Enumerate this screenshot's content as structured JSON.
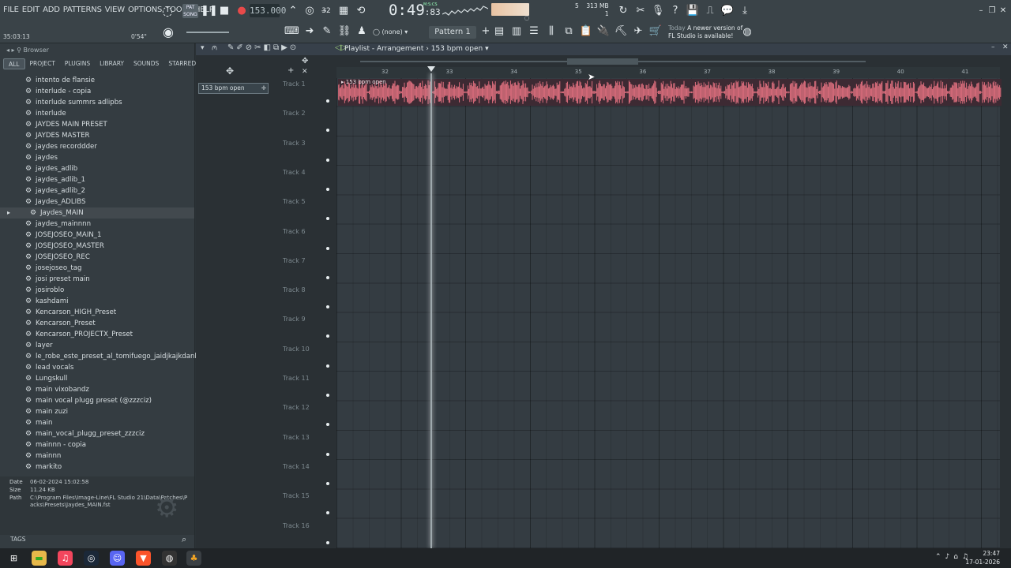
{
  "menu": [
    "FILE",
    "EDIT",
    "ADD",
    "PATTERNS",
    "VIEW",
    "OPTIONS",
    "TOOLS",
    "HELP"
  ],
  "transport": {
    "mode": "SONG",
    "pat_label": "PAT",
    "tempo": "153.000",
    "time": "0:49",
    "time_frac": ":83",
    "time_units": "M:S:CS",
    "cpu_value": "5",
    "ram": "313 MB",
    "poly": "1"
  },
  "hint_bar": {
    "left": "35:03:13",
    "right": "0'54\""
  },
  "pattern": {
    "label": "Pattern 1",
    "channel": "(none)"
  },
  "update_notice": {
    "day": "Today",
    "line1": "A newer version of",
    "line2": "FL Studio is available!"
  },
  "browser": {
    "title": "Browser",
    "tabs": [
      "ALL",
      "PROJECT",
      "PLUGINS",
      "LIBRARY",
      "SOUNDS",
      "STARRED"
    ],
    "files": [
      "intento de flansie",
      "interlude - copia",
      "interlude summrs adlipbs",
      "interlude",
      "JAYDES MAIN PRESET",
      "JAYDES MASTER",
      "jaydes recorddder",
      "jaydes",
      "jaydes_adlib",
      "jaydes_adlib_1",
      "jaydes_adlib_2",
      "Jaydes_ADLIBS",
      "Jaydes_MAIN",
      "jaydes_mainnnn",
      "JOSEJOSEO_MAIN_1",
      "JOSEJOSEO_MASTER",
      "JOSEJOSEO_REC",
      "josejoseo_tag",
      "josi preset main",
      "josiroblo",
      "kashdami",
      "Kencarson_HIGH_Preset",
      "Kencarson_Preset",
      "Kencarson_PROJECTX_Preset",
      "layer",
      "le_robe_este_preset_al_tomifuego_jaidjkajkdanksnda",
      "lead vocals",
      "Lungskull",
      "main vixobandz",
      "main vocal plugg preset (@zzzciz)",
      "main zuzi",
      "main",
      "main_vocal_plugg_preset_zzzciz",
      "mainnn - copia",
      "mainnn",
      "markito"
    ],
    "selected_file": "Jaydes_MAIN",
    "info": {
      "date_label": "Date",
      "date": "06-02-2024 15:02:58",
      "size_label": "Size",
      "size": "11.24 KB",
      "path_label": "Path",
      "path": "C:\\Program Files\\Image-Line\\FL Studio 21\\Data\\Patches\\Packs\\Presets\\Jaydes_MAIN.fst"
    },
    "tags_label": "TAGS"
  },
  "playlist": {
    "title": "Playlist - Arrangement",
    "pattern_name": "153 bpm open",
    "picker_item": "153 bpm open",
    "clip_label": "153 bpm open",
    "bars": [
      "32",
      "33",
      "34",
      "35",
      "36",
      "37",
      "38",
      "39",
      "40",
      "41"
    ],
    "tracks": [
      "Track 1",
      "Track 2",
      "Track 3",
      "Track 4",
      "Track 5",
      "Track 6",
      "Track 7",
      "Track 8",
      "Track 9",
      "Track 10",
      "Track 11",
      "Track 12",
      "Track 13",
      "Track 14",
      "Track 15",
      "Track 16"
    ]
  },
  "taskbar": {
    "time": "23:47",
    "date": "17-01-2026"
  },
  "colors": {
    "clip_wave": "#e0707f",
    "clip_bg": "#3d2a33",
    "accent_red": "#e84a4a"
  }
}
